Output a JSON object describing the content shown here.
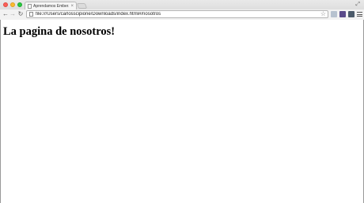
{
  "browser": {
    "tab": {
      "title": "Aprendamos Ember.js en"
    },
    "address": {
      "url": "file:///Users/carlosscipione/Downloads/index.html#/nosotros"
    },
    "icons": {
      "back": "arrow-left",
      "forward": "arrow-right",
      "reload": "reload",
      "star": "star",
      "menu": "hamburger"
    }
  },
  "page": {
    "heading": "La pagina de nosotros!"
  }
}
